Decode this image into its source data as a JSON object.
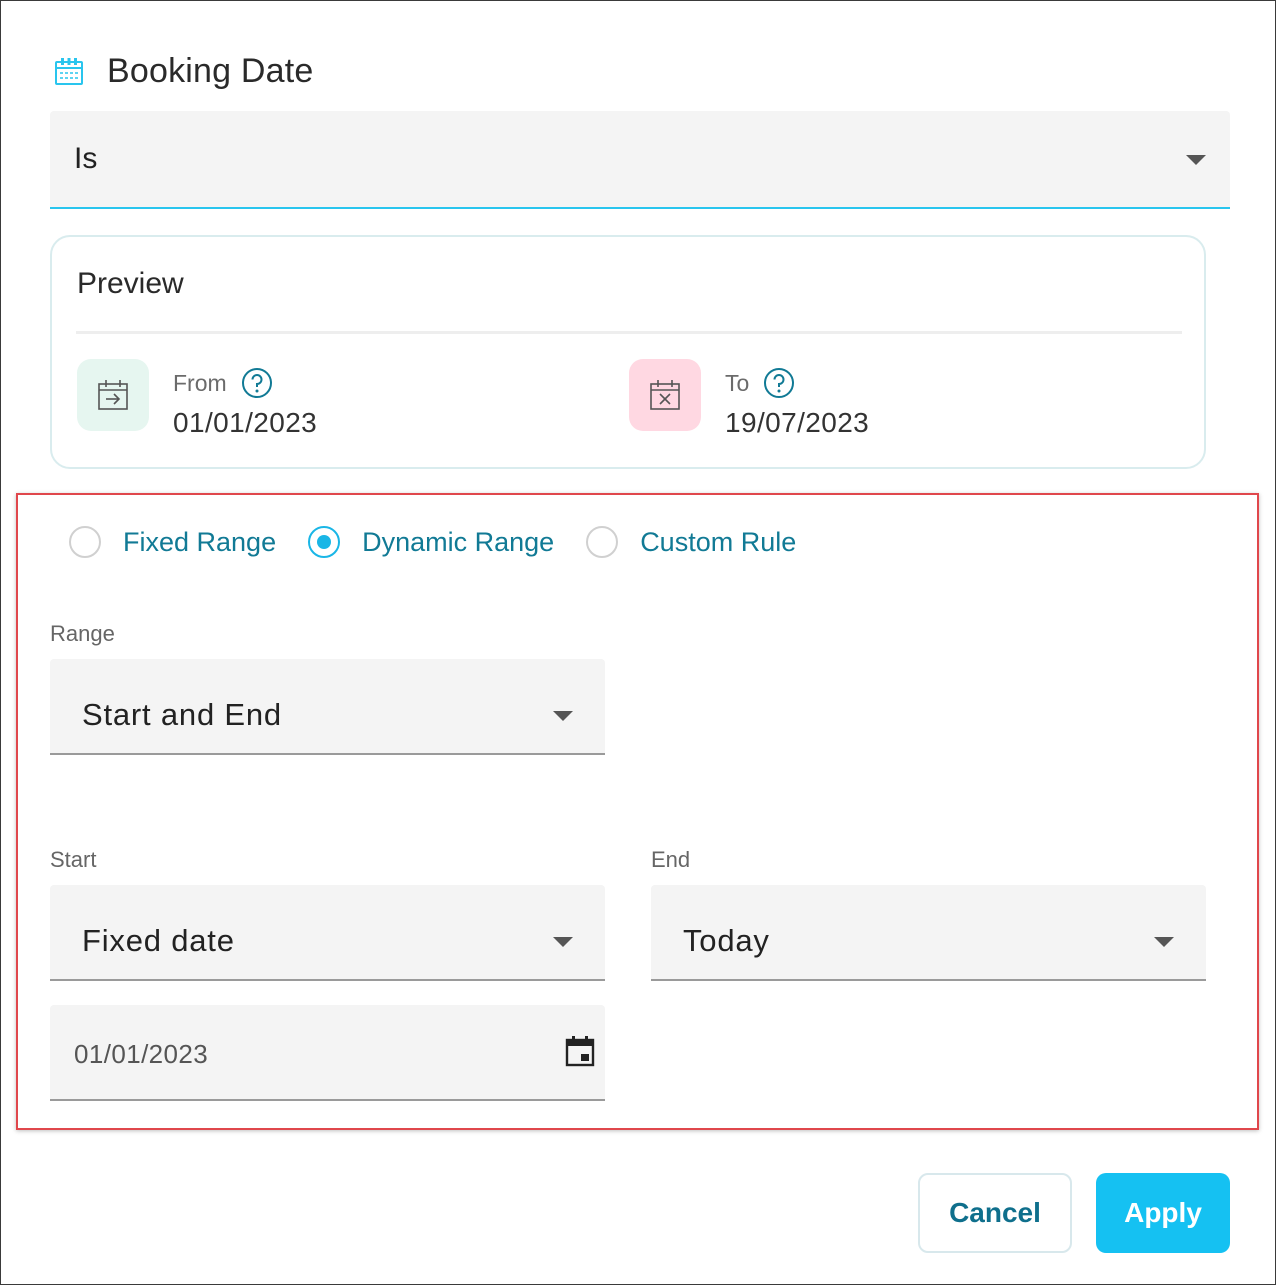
{
  "header": {
    "title": "Booking Date",
    "icon": "calendar-icon",
    "accent": "#29c5ee"
  },
  "operator": {
    "selected": "Is"
  },
  "preview": {
    "title": "Preview",
    "from": {
      "label": "From",
      "value": "01/01/2023",
      "icon": "calendar-arrow-icon"
    },
    "to": {
      "label": "To",
      "value": "19/07/2023",
      "icon": "calendar-x-icon"
    }
  },
  "range_modes": {
    "options": [
      "Fixed Range",
      "Dynamic Range",
      "Custom Rule"
    ],
    "selected": "Dynamic Range"
  },
  "range": {
    "label": "Range",
    "selected": "Start and End"
  },
  "start": {
    "label": "Start",
    "selected": "Fixed date",
    "date_value": "01/01/2023"
  },
  "end": {
    "label": "End",
    "selected": "Today"
  },
  "actions": {
    "cancel": "Cancel",
    "apply": "Apply"
  },
  "colors": {
    "primary": "#15c1f2",
    "link": "#117a95",
    "highlight": "#e0474c"
  }
}
